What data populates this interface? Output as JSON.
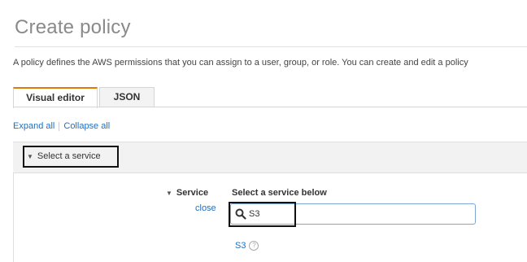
{
  "page": {
    "title": "Create policy",
    "description": "A policy defines the AWS permissions that you can assign to a user, group, or role. You can create and edit a policy"
  },
  "tabs": [
    {
      "label": "Visual editor",
      "active": true
    },
    {
      "label": "JSON",
      "active": false
    }
  ],
  "controls": {
    "expand_all": "Expand all",
    "collapse_all": "Collapse all"
  },
  "panel": {
    "header": "Select a service",
    "service_label": "Service",
    "close_label": "close",
    "select_heading": "Select a service below",
    "search_value": "S3",
    "result": "S3"
  },
  "icons": {
    "caret": "caret-down-icon",
    "search": "search-icon",
    "help": "help-icon"
  },
  "colors": {
    "accent_tab": "#e07b00",
    "link": "#1f6fbf",
    "search_border": "#7aa7d6"
  }
}
